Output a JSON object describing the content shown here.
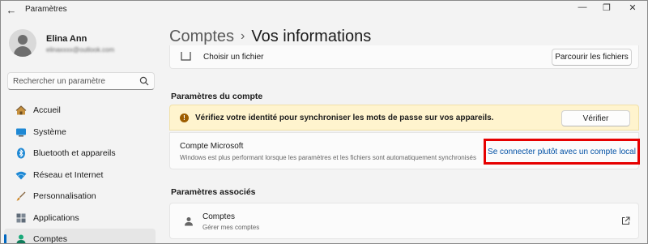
{
  "window": {
    "title": "Paramètres",
    "back_icon": "←",
    "minimize_icon": "—",
    "maximize_icon": "❐",
    "close_icon": "✕"
  },
  "profile": {
    "name": "Elina Ann",
    "email": "elinaxxxx@outlook.com"
  },
  "search": {
    "placeholder": "Rechercher un paramètre"
  },
  "sidebar": {
    "items": [
      {
        "label": "Accueil",
        "icon": "home-icon",
        "selected": false
      },
      {
        "label": "Système",
        "icon": "monitor-icon",
        "selected": false
      },
      {
        "label": "Bluetooth et appareils",
        "icon": "bluetooth-icon",
        "selected": false
      },
      {
        "label": "Réseau et Internet",
        "icon": "wifi-icon",
        "selected": false
      },
      {
        "label": "Personnalisation",
        "icon": "brush-icon",
        "selected": false
      },
      {
        "label": "Applications",
        "icon": "apps-icon",
        "selected": false
      },
      {
        "label": "Comptes",
        "icon": "person-icon",
        "selected": true
      }
    ]
  },
  "header": {
    "parent": "Comptes",
    "separator": "›",
    "current": "Vos informations"
  },
  "photo": {
    "label": "Choisir un fichier",
    "button": "Parcourir les fichiers"
  },
  "account_settings": {
    "title": "Paramètres du compte",
    "warning_text": "Vérifiez votre identité pour synchroniser les mots de passe sur vos appareils.",
    "verify_button": "Vérifier",
    "ms_title": "Compte Microsoft",
    "ms_desc": "Windows est plus performant lorsque les paramètres et les fichiers sont automatiquement synchronisés",
    "ms_link": "Se connecter plutôt avec un compte local"
  },
  "related": {
    "title": "Paramètres associés",
    "accounts_title": "Comptes",
    "accounts_desc": "Gérer mes comptes"
  },
  "colors": {
    "accent": "#0067c0",
    "link": "#0050a5",
    "highlight_box": "#e60000",
    "warning_bg": "#fff4ce"
  }
}
